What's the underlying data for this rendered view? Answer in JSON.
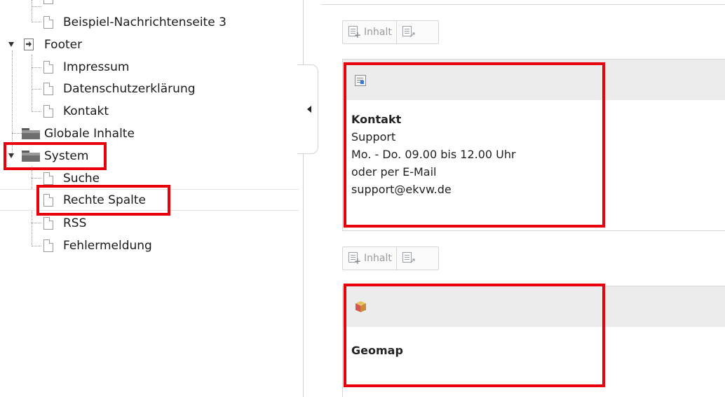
{
  "tree": {
    "items": [
      {
        "label": "Beispiel-Nachrichtenseite 3"
      },
      {
        "label": "Footer"
      },
      {
        "label": "Impressum"
      },
      {
        "label": "Datenschutzerklärung"
      },
      {
        "label": "Kontakt"
      },
      {
        "label": "Globale Inhalte"
      },
      {
        "label": "System"
      },
      {
        "label": "Suche"
      },
      {
        "label": "Rechte Spalte"
      },
      {
        "label": "RSS"
      },
      {
        "label": "Fehlermeldung"
      }
    ]
  },
  "content": {
    "new_content_label": "Inhalt",
    "elements": [
      {
        "title": "Kontakt",
        "lines": [
          "Support",
          "Mo. - Do. 09.00 bis 12.00 Uhr",
          "oder per E-Mail",
          "support@ekvw.de"
        ],
        "icon": "text-media-icon"
      },
      {
        "title": "Geomap",
        "icon": "plugin-cube-icon"
      }
    ]
  },
  "annotation_color": "#e8000b"
}
